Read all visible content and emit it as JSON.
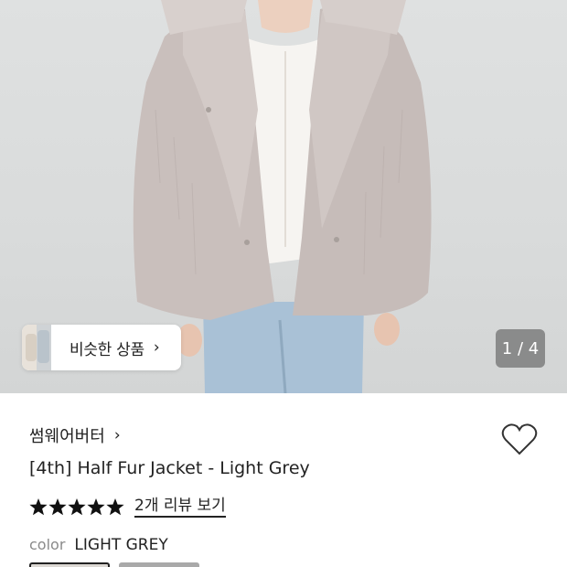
{
  "product_image": {
    "similar_products_label": "비슷한 상품",
    "page_indicator": "1 / 4"
  },
  "product": {
    "brand": "썸웨어버터",
    "title": "[4th] Half Fur Jacket - Light Grey",
    "rating_stars": 5,
    "review_link": "2개 리뷰 보기",
    "color_label": "color",
    "color_value": "LIGHT GREY"
  },
  "icons": {
    "similar_chevron": "chevron-right-icon",
    "brand_chevron": "chevron-right-icon",
    "wishlist": "heart-outline-icon",
    "rating": "star-filled-icon"
  },
  "colors": {
    "text": "#222222",
    "muted": "#8a8a8a",
    "indicator_bg": "#6e6e6e",
    "coat": "#c9bfbc"
  }
}
